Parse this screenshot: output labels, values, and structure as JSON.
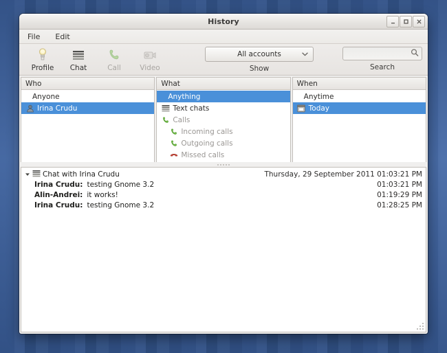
{
  "window": {
    "title": "History",
    "controls": [
      {
        "name": "minimize-button",
        "glyph": "minimize"
      },
      {
        "name": "maximize-button",
        "glyph": "maximize"
      },
      {
        "name": "close-button",
        "glyph": "close"
      }
    ]
  },
  "menubar": {
    "items": [
      {
        "label": "File"
      },
      {
        "label": "Edit"
      }
    ]
  },
  "toolbar": {
    "buttons": [
      {
        "label": "Profile",
        "icon": "profile-icon",
        "disabled": false
      },
      {
        "label": "Chat",
        "icon": "chat-icon",
        "disabled": false
      },
      {
        "label": "Call",
        "icon": "call-icon",
        "disabled": true
      },
      {
        "label": "Video",
        "icon": "video-icon",
        "disabled": true
      }
    ],
    "show": {
      "label": "Show",
      "account_value": "All accounts",
      "chevron": "chevron-down-icon"
    },
    "search": {
      "label": "Search",
      "value": "",
      "placeholder": "",
      "icon": "search-icon"
    }
  },
  "filters": {
    "who": {
      "header": "Who",
      "rows": [
        {
          "label": "Anyone",
          "icon": null,
          "selected": false,
          "dim": false,
          "indent": false
        },
        {
          "label": "Irina Crudu",
          "icon": "avatar-icon",
          "selected": true,
          "dim": false,
          "indent": false
        }
      ]
    },
    "what": {
      "header": "What",
      "rows": [
        {
          "label": "Anything",
          "icon": null,
          "selected": true,
          "dim": false,
          "indent": false
        },
        {
          "label": "Text chats",
          "icon": "text-chats-icon",
          "selected": false,
          "dim": false,
          "indent": false
        },
        {
          "label": "Calls",
          "icon": "call-green-icon",
          "selected": false,
          "dim": true,
          "indent": false
        },
        {
          "label": "Incoming calls",
          "icon": "call-green-icon",
          "selected": false,
          "dim": true,
          "indent": true
        },
        {
          "label": "Outgoing calls",
          "icon": "call-green-icon",
          "selected": false,
          "dim": true,
          "indent": true
        },
        {
          "label": "Missed calls",
          "icon": "call-red-icon",
          "selected": false,
          "dim": true,
          "indent": true
        }
      ]
    },
    "when": {
      "header": "When",
      "rows": [
        {
          "label": "Anytime",
          "icon": null,
          "selected": false,
          "dim": false,
          "indent": false
        },
        {
          "label": "Today",
          "icon": "calendar-icon",
          "selected": true,
          "dim": false,
          "indent": false
        }
      ]
    }
  },
  "log": {
    "group": {
      "expander": "expander-down-icon",
      "icon": "text-chats-icon",
      "title": "Chat with Irina Crudu",
      "timestamp": "Thursday, 29 September 2011 01:03:21 PM"
    },
    "messages": [
      {
        "sender": "Irina Crudu:",
        "text": "testing Gnome 3.2",
        "timestamp": "01:03:21 PM"
      },
      {
        "sender": "Alin-Andrei:",
        "text": "it works!",
        "timestamp": "01:19:29 PM"
      },
      {
        "sender": "Irina Crudu:",
        "text": "testing Gnome 3.2",
        "timestamp": "01:28:25 PM"
      }
    ]
  },
  "colors": {
    "selection_blue": "#4a90d9",
    "window_chrome": "#f0efee",
    "desktop_blue": "#3f639f",
    "call_green": "#6fbf4a",
    "call_red": "#c0392b"
  }
}
